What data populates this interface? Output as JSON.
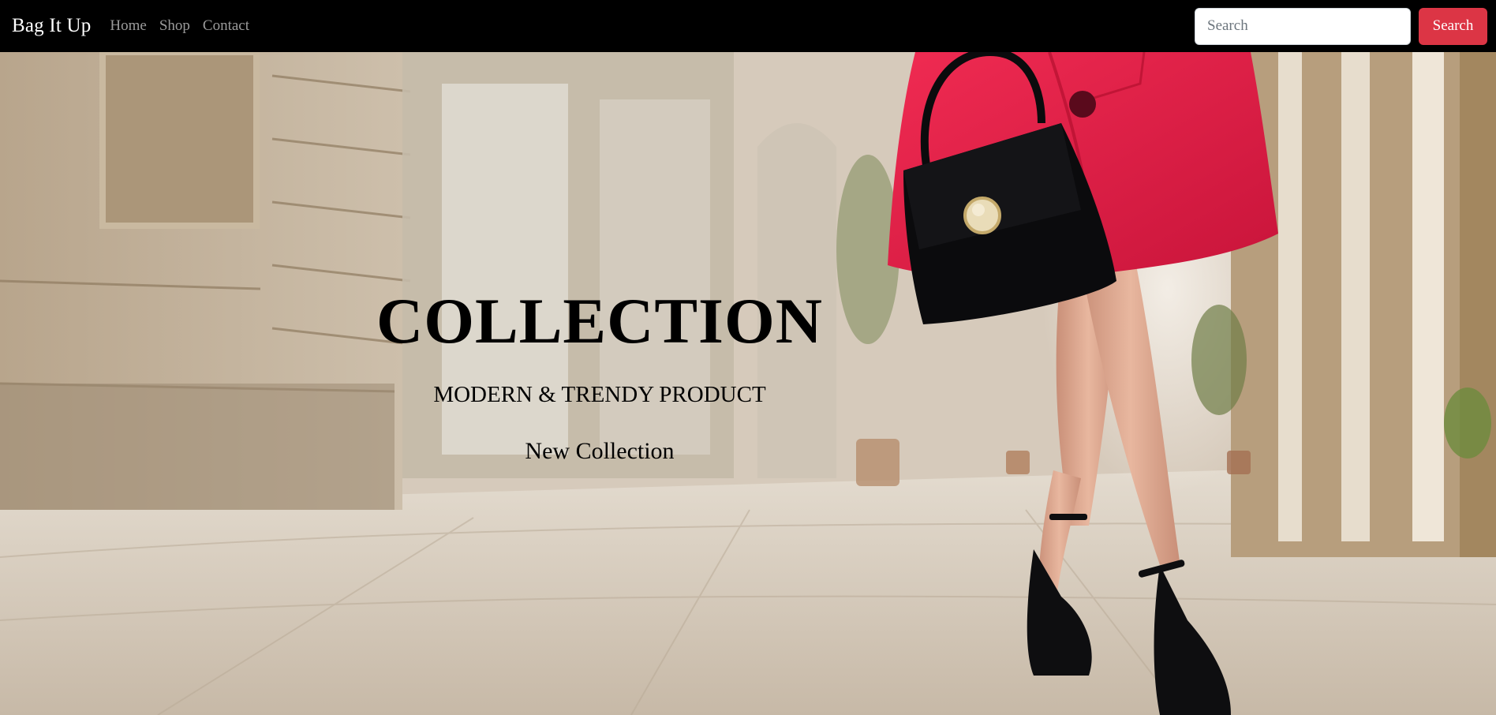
{
  "navbar": {
    "brand": "Bag It Up",
    "links": [
      "Home",
      "Shop",
      "Contact"
    ],
    "search_placeholder": "Search",
    "search_button": "Search"
  },
  "hero": {
    "title": "COLLECTION",
    "subtitle": "MODERN & TRENDY PRODUCT",
    "cta": "New Collection"
  },
  "colors": {
    "navbar_bg": "#000000",
    "search_button_bg": "#dc3545",
    "coat": "#e8204a",
    "bag": "#0b0b0d"
  }
}
